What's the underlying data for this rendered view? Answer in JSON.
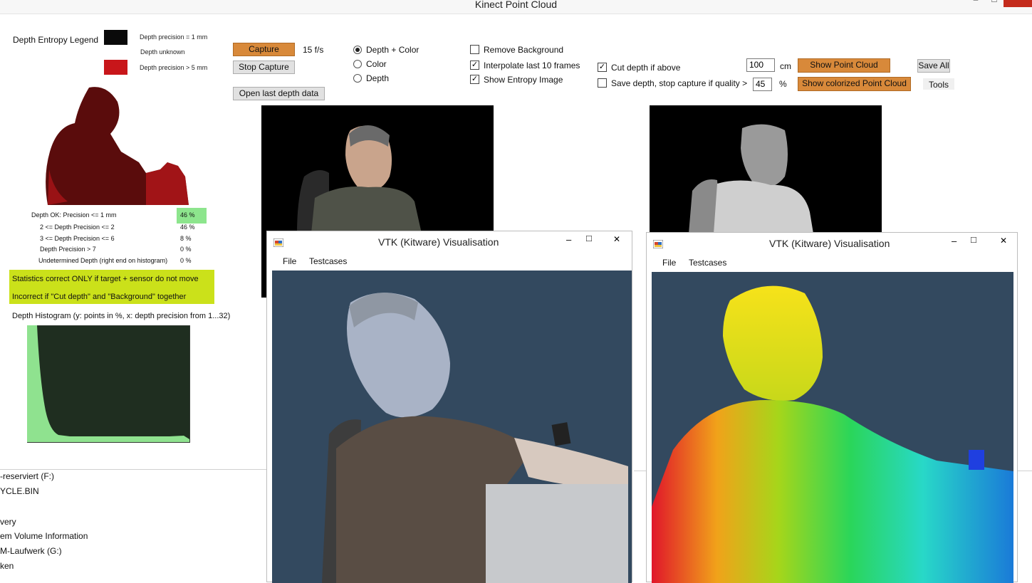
{
  "window": {
    "title": "Kinect Point Cloud",
    "minimize": "–",
    "maximize": "□"
  },
  "legend": {
    "title": "Depth Entropy Legend",
    "item1": "Depth precision = 1 mm",
    "item2": "Depth  unknown",
    "item3": "Depth precision > 5 mm",
    "colors": {
      "black": "#0a0a0a",
      "red": "#c8161a"
    }
  },
  "controls": {
    "capture": "Capture",
    "fps": "15 f/s",
    "stop_capture": "Stop Capture",
    "open_last": "Open last depth data",
    "radio_depth_color": "Depth + Color",
    "radio_color": "Color",
    "radio_depth": "Depth",
    "remove_background": "Remove Background",
    "interpolate": "Interpolate last 10 frames",
    "show_entropy": "Show Entropy Image",
    "cut_depth": "Cut depth if above",
    "cut_value": "100",
    "cut_unit": "cm",
    "save_depth": "Save depth, stop capture if quality >",
    "quality_value": "45",
    "quality_unit": "%",
    "show_point_cloud": "Show Point Cloud",
    "show_colorized": "Show colorized Point Cloud",
    "save_all": "Save All",
    "tools": "Tools",
    "check_mark": "✓"
  },
  "stats": {
    "rows": [
      {
        "label": "Depth OK: Precision <= 1 mm",
        "value": "46 %"
      },
      {
        "label": "2 <= Depth Precision <= 2",
        "value": "46 %"
      },
      {
        "label": "3 <= Depth Precision <= 6",
        "value": "8 %"
      },
      {
        "label": "Depth Precision > 7",
        "value": "0 %"
      },
      {
        "label": "Undetermined Depth (right end on histogram)",
        "value": "0 %"
      }
    ],
    "note1": "Statistics correct ONLY if target + sensor do not move",
    "note2": "Incorrect if \"Cut depth\" and \"Background\" together",
    "histogram_title": "Depth Histogram (y: points in %, x: depth precision from 1...32)"
  },
  "vtk_left": {
    "title": "VTK (Kitware) Visualisation",
    "menu_file": "File",
    "menu_testcases": "Testcases",
    "minimize": "–",
    "maximize": "□",
    "close": "✕"
  },
  "vtk_right": {
    "title": "VTK (Kitware) Visualisation",
    "menu_file": "File",
    "menu_testcases": "Testcases",
    "minimize": "–",
    "maximize": "□",
    "close": "✕"
  },
  "explorer": {
    "items": [
      "-reserviert (F:)",
      "YCLE.BIN",
      "very",
      "em Volume Information",
      "M-Laufwerk (G:)",
      "ken"
    ]
  }
}
